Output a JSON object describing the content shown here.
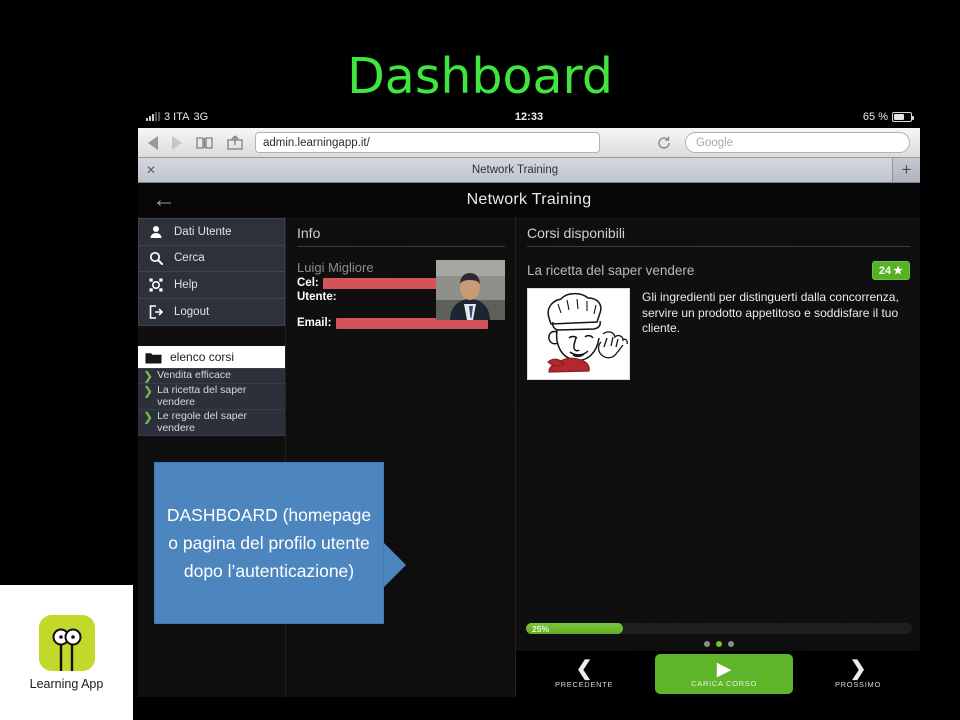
{
  "slide": {
    "title": "Dashboard",
    "title_color": "#3ee63e",
    "background_color": "#000000"
  },
  "status_bar": {
    "carrier": "3 ITA",
    "network": "3G",
    "time": "12:33",
    "battery_text": "65 %",
    "battery_percent": 65,
    "signal_icon": "signal-bars-icon",
    "battery_icon": "battery-icon"
  },
  "browser": {
    "back_icon": "back-triangle-icon",
    "forward_icon": "forward-triangle-icon",
    "bookmarks_icon": "book-icon",
    "share_icon": "share-icon",
    "url": "admin.learningapp.it/",
    "reload_icon": "reload-icon",
    "search_placeholder": "Google",
    "tab": {
      "label": "Network Training",
      "close_icon": "close-icon",
      "new_tab_icon": "plus-icon"
    }
  },
  "app": {
    "header": {
      "back_icon": "arrow-left-icon",
      "title": "Network Training"
    },
    "sidebar": {
      "menu": [
        {
          "label": "Dati Utente",
          "icon": "user-icon"
        },
        {
          "label": "Cerca",
          "icon": "search-icon"
        },
        {
          "label": "Help",
          "icon": "help-icon"
        },
        {
          "label": "Logout",
          "icon": "logout-icon"
        }
      ],
      "folder": {
        "label": "elenco corsi",
        "icon": "folder-icon"
      },
      "courses": [
        {
          "label": "Vendita efficace",
          "icon": "chevron-right-icon"
        },
        {
          "label": "La ricetta del saper vendere",
          "icon": "chevron-right-icon"
        },
        {
          "label": "Le regole del saper vendere",
          "icon": "chevron-right-icon"
        }
      ]
    },
    "info": {
      "panel_title": "Info",
      "user_name": "Luigi Migliore",
      "fields": [
        {
          "label": "Cel:",
          "value": "",
          "redacted": true
        },
        {
          "label": "Utente:",
          "value": "",
          "redacted": false
        },
        {
          "label": "Email:",
          "value": "",
          "redacted": true
        }
      ],
      "photo_alt": "user-photo"
    },
    "courses_panel": {
      "panel_title": "Corsi disponibili",
      "course_title": "La ricetta del saper vendere",
      "badge_value": "24",
      "badge_icon": "star-icon",
      "badge_color": "#56b124",
      "description": "Gli ingredienti per distinguerti dalla concorrenza, servire un prodotto appetitoso e soddisfare il tuo cliente.",
      "thumbnail_alt": "chef-illustration"
    },
    "progress": {
      "percent_label": "25%",
      "percent_value": 25,
      "dots_total": 3,
      "dot_active_index": 1
    },
    "bottom_nav": [
      {
        "label": "PRECEDENTE",
        "icon": "chevron-left-icon",
        "primary": false
      },
      {
        "label": "CARICA CORSO",
        "icon": "play-icon",
        "primary": true
      },
      {
        "label": "PROSSIMO",
        "icon": "chevron-right-icon",
        "primary": false
      }
    ]
  },
  "callout": {
    "text": "DASHBOARD (homepage o pagina del profilo utente dopo l’autenticazione)",
    "color": "#4d85be"
  },
  "logo": {
    "text": "Learning App",
    "mark_color": "#c2d92b",
    "mark_icon": "learning-app-eyes-icon"
  }
}
